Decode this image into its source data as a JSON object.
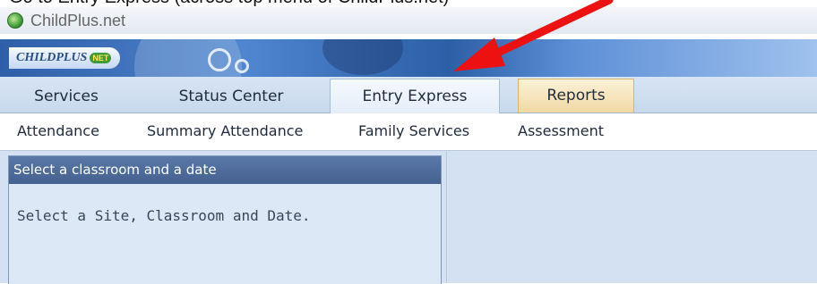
{
  "caption": "Go to Entry Express (across top menu of ChildPlus.net)",
  "window": {
    "title": "ChildPlus.net"
  },
  "banner": {
    "logo_text": "CHILDPLUS",
    "logo_badge": "NET"
  },
  "main_tabs": [
    {
      "label": "Services"
    },
    {
      "label": "Status Center"
    },
    {
      "label": "Entry Express"
    },
    {
      "label": "Reports"
    }
  ],
  "sub_tabs": [
    {
      "label": "Attendance"
    },
    {
      "label": "Summary Attendance"
    },
    {
      "label": "Family Services"
    },
    {
      "label": "Assessment"
    }
  ],
  "panel": {
    "header": "Select a classroom and a date",
    "message": "Select a Site, Classroom and Date."
  },
  "colors": {
    "arrow": "#ee1111",
    "panel_header": "#4a6796",
    "reports_tab": "#f2d9a3"
  }
}
